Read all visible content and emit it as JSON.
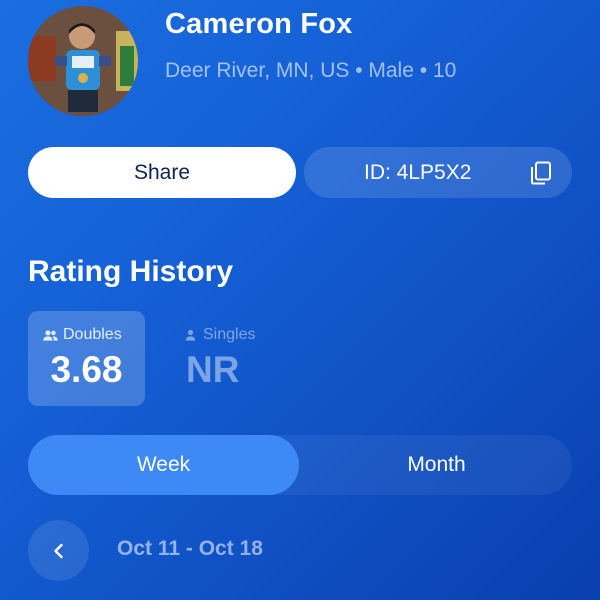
{
  "profile": {
    "name": "Cameron Fox",
    "meta": "Deer River, MN, US • Male • 10",
    "avatar_icon": "profile-photo"
  },
  "actions": {
    "share_label": "Share",
    "id_label": "ID: 4LP5X2",
    "copy_icon": "copy-icon"
  },
  "rating_history": {
    "title": "Rating History",
    "cards": [
      {
        "label": "Doubles",
        "value": "3.68",
        "icon": "people-icon",
        "active": true
      },
      {
        "label": "Singles",
        "value": "NR",
        "icon": "person-icon",
        "active": false
      }
    ]
  },
  "period": {
    "options": [
      "Week",
      "Month"
    ],
    "selected": "Week"
  },
  "date_nav": {
    "range": "Oct 11 - Oct 18",
    "prev_icon": "chevron-left-icon"
  },
  "colors": {
    "bg_start": "#1a6ee0",
    "bg_end": "#0a3fae",
    "accent": "#3d8af7",
    "share_text": "#0e2350"
  }
}
